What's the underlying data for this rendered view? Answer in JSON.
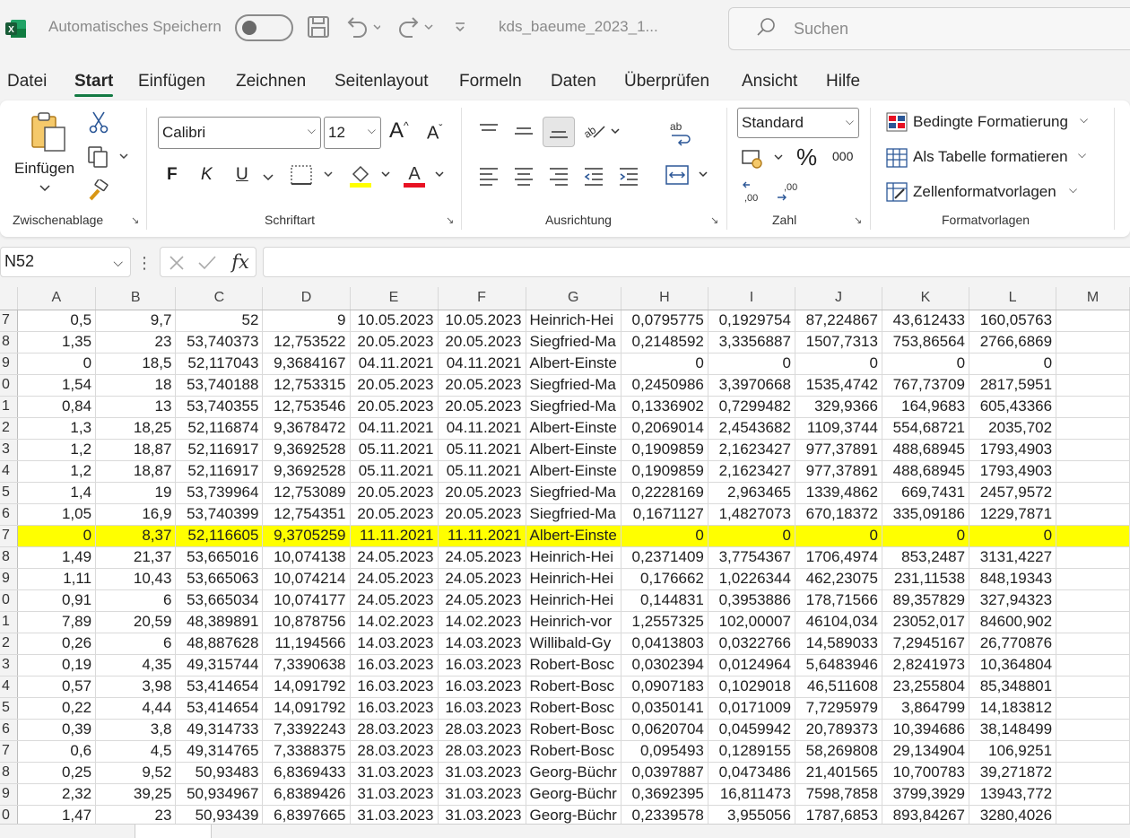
{
  "titlebar": {
    "autosave_label": "Automatisches Speichern",
    "filename": "kds_baeume_2023_1...",
    "search_placeholder": "Suchen"
  },
  "menu": {
    "tabs": [
      "Datei",
      "Start",
      "Einfügen",
      "Zeichnen",
      "Seitenlayout",
      "Formeln",
      "Daten",
      "Überprüfen",
      "Ansicht",
      "Hilfe"
    ],
    "active": "Start"
  },
  "ribbon": {
    "clipboard": {
      "group_label": "Zwischenablage",
      "paste_label": "Einfügen"
    },
    "font": {
      "group_label": "Schriftart",
      "font_name": "Calibri",
      "font_size": "12",
      "bold": "F",
      "italic": "K",
      "underline": "U"
    },
    "alignment": {
      "group_label": "Ausrichtung"
    },
    "number": {
      "group_label": "Zahl",
      "format": "Standard",
      "thousands": "000",
      "percent": "%"
    },
    "styles": {
      "group_label": "Formatvorlagen",
      "conditional": "Bedingte Formatierung",
      "as_table": "Als Tabelle formatieren",
      "cell_styles": "Zellenformatvorlagen"
    }
  },
  "formula_bar": {
    "name_box": "N52",
    "formula": ""
  },
  "grid": {
    "columns": [
      "A",
      "B",
      "C",
      "D",
      "E",
      "F",
      "G",
      "H",
      "I",
      "J",
      "K",
      "L",
      "M"
    ],
    "highlight_color": "#ffff00",
    "highlighted_row": "7",
    "rows": [
      [
        "7",
        "0,5",
        "9,7",
        "52",
        "9",
        "10.05.2023",
        "10.05.2023",
        "Heinrich-Hei",
        "0,0795775",
        "0,1929754",
        "87,224867",
        "43,612433",
        "160,05763"
      ],
      [
        "8",
        "1,35",
        "23",
        "53,740373",
        "12,753522",
        "20.05.2023",
        "20.05.2023",
        "Siegfried-Ma",
        "0,2148592",
        "3,3356887",
        "1507,7313",
        "753,86564",
        "2766,6869"
      ],
      [
        "9",
        "0",
        "18,5",
        "52,117043",
        "9,3684167",
        "04.11.2021",
        "04.11.2021",
        "Albert-Einste",
        "0",
        "0",
        "0",
        "0",
        "0"
      ],
      [
        "0",
        "1,54",
        "18",
        "53,740188",
        "12,753315",
        "20.05.2023",
        "20.05.2023",
        "Siegfried-Ma",
        "0,2450986",
        "3,3970668",
        "1535,4742",
        "767,73709",
        "2817,5951"
      ],
      [
        "1",
        "0,84",
        "13",
        "53,740355",
        "12,753546",
        "20.05.2023",
        "20.05.2023",
        "Siegfried-Ma",
        "0,1336902",
        "0,7299482",
        "329,9366",
        "164,9683",
        "605,43366"
      ],
      [
        "2",
        "1,3",
        "18,25",
        "52,116874",
        "9,3678472",
        "04.11.2021",
        "04.11.2021",
        "Albert-Einste",
        "0,2069014",
        "2,4543682",
        "1109,3744",
        "554,68721",
        "2035,702"
      ],
      [
        "3",
        "1,2",
        "18,87",
        "52,116917",
        "9,3692528",
        "05.11.2021",
        "05.11.2021",
        "Albert-Einste",
        "0,1909859",
        "2,1623427",
        "977,37891",
        "488,68945",
        "1793,4903"
      ],
      [
        "4",
        "1,2",
        "18,87",
        "52,116917",
        "9,3692528",
        "05.11.2021",
        "05.11.2021",
        "Albert-Einste",
        "0,1909859",
        "2,1623427",
        "977,37891",
        "488,68945",
        "1793,4903"
      ],
      [
        "5",
        "1,4",
        "19",
        "53,739964",
        "12,753089",
        "20.05.2023",
        "20.05.2023",
        "Siegfried-Ma",
        "0,2228169",
        "2,963465",
        "1339,4862",
        "669,7431",
        "2457,9572"
      ],
      [
        "6",
        "1,05",
        "16,9",
        "53,740399",
        "12,754351",
        "20.05.2023",
        "20.05.2023",
        "Siegfried-Ma",
        "0,1671127",
        "1,4827073",
        "670,18372",
        "335,09186",
        "1229,7871"
      ],
      [
        "7",
        "0",
        "8,37",
        "52,116605",
        "9,3705259",
        "11.11.2021",
        "11.11.2021",
        "Albert-Einste",
        "0",
        "0",
        "0",
        "0",
        "0"
      ],
      [
        "8",
        "1,49",
        "21,37",
        "53,665016",
        "10,074138",
        "24.05.2023",
        "24.05.2023",
        "Heinrich-Hei",
        "0,2371409",
        "3,7754367",
        "1706,4974",
        "853,2487",
        "3131,4227"
      ],
      [
        "9",
        "1,11",
        "10,43",
        "53,665063",
        "10,074214",
        "24.05.2023",
        "24.05.2023",
        "Heinrich-Hei",
        "0,176662",
        "1,0226344",
        "462,23075",
        "231,11538",
        "848,19343"
      ],
      [
        "0",
        "0,91",
        "6",
        "53,665034",
        "10,074177",
        "24.05.2023",
        "24.05.2023",
        "Heinrich-Hei",
        "0,144831",
        "0,3953886",
        "178,71566",
        "89,357829",
        "327,94323"
      ],
      [
        "1",
        "7,89",
        "20,59",
        "48,389891",
        "10,878756",
        "14.02.2023",
        "14.02.2023",
        "Heinrich-vor",
        "1,2557325",
        "102,00007",
        "46104,034",
        "23052,017",
        "84600,902"
      ],
      [
        "2",
        "0,26",
        "6",
        "48,887628",
        "11,194566",
        "14.03.2023",
        "14.03.2023",
        "Willibald-Gy",
        "0,0413803",
        "0,0322766",
        "14,589033",
        "7,2945167",
        "26,770876"
      ],
      [
        "3",
        "0,19",
        "4,35",
        "49,315744",
        "7,3390638",
        "16.03.2023",
        "16.03.2023",
        "Robert-Bosc",
        "0,0302394",
        "0,0124964",
        "5,6483946",
        "2,8241973",
        "10,364804"
      ],
      [
        "4",
        "0,57",
        "3,98",
        "53,414654",
        "14,091792",
        "16.03.2023",
        "16.03.2023",
        "Robert-Bosc",
        "0,0907183",
        "0,1029018",
        "46,511608",
        "23,255804",
        "85,348801"
      ],
      [
        "5",
        "0,22",
        "4,44",
        "53,414654",
        "14,091792",
        "16.03.2023",
        "16.03.2023",
        "Robert-Bosc",
        "0,0350141",
        "0,0171009",
        "7,7295979",
        "3,864799",
        "14,183812"
      ],
      [
        "6",
        "0,39",
        "3,8",
        "49,314733",
        "7,3392243",
        "28.03.2023",
        "28.03.2023",
        "Robert-Bosc",
        "0,0620704",
        "0,0459942",
        "20,789373",
        "10,394686",
        "38,148499"
      ],
      [
        "7",
        "0,6",
        "4,5",
        "49,314765",
        "7,3388375",
        "28.03.2023",
        "28.03.2023",
        "Robert-Bosc",
        "0,095493",
        "0,1289155",
        "58,269808",
        "29,134904",
        "106,9251"
      ],
      [
        "8",
        "0,25",
        "9,52",
        "50,93483",
        "6,8369433",
        "31.03.2023",
        "31.03.2023",
        "Georg-Büchr",
        "0,0397887",
        "0,0473486",
        "21,401565",
        "10,700783",
        "39,271872"
      ],
      [
        "9",
        "2,32",
        "39,25",
        "50,934967",
        "6,8389426",
        "31.03.2023",
        "31.03.2023",
        "Georg-Büchr",
        "0,3692395",
        "16,811473",
        "7598,7858",
        "3799,3929",
        "13943,772"
      ],
      [
        "0",
        "1,47",
        "23",
        "50,93439",
        "6,8397665",
        "31.03.2023",
        "31.03.2023",
        "Georg-Büchr",
        "0,2339578",
        "3,955056",
        "1787,6853",
        "893,84267",
        "3280,4026"
      ]
    ]
  }
}
